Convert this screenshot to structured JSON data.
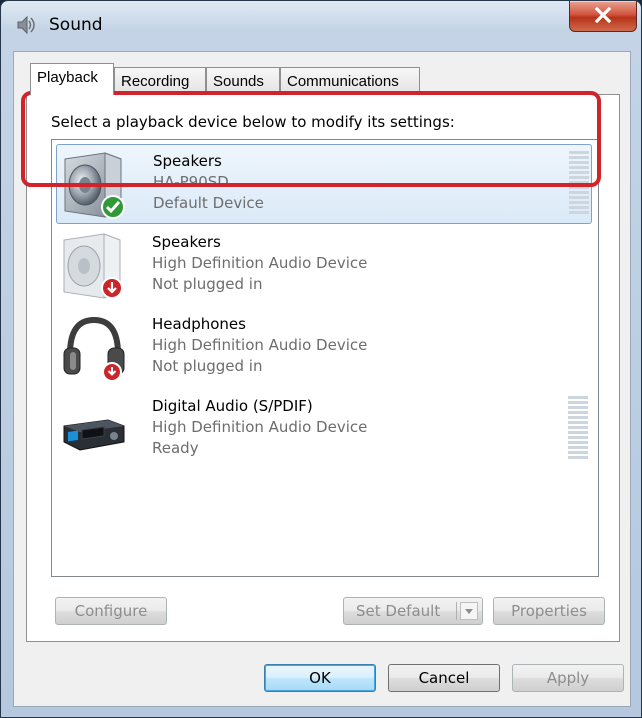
{
  "window": {
    "title": "Sound"
  },
  "tabs": [
    {
      "label": "Playback",
      "active": true
    },
    {
      "label": "Recording",
      "active": false
    },
    {
      "label": "Sounds",
      "active": false
    },
    {
      "label": "Communications",
      "active": false
    }
  ],
  "instruction": "Select a playback device below to modify its settings:",
  "devices": [
    {
      "name": "Speakers",
      "description": "HA-P90SD",
      "status": "Default Device",
      "icon": "speaker-default-icon",
      "selected": true
    },
    {
      "name": "Speakers",
      "description": "High Definition Audio Device",
      "status": "Not plugged in",
      "icon": "speaker-unplugged-icon",
      "selected": false
    },
    {
      "name": "Headphones",
      "description": "High Definition Audio Device",
      "status": "Not plugged in",
      "icon": "headphones-unplugged-icon",
      "selected": false
    },
    {
      "name": "Digital Audio (S/PDIF)",
      "description": "High Definition Audio Device",
      "status": "Ready",
      "icon": "digital-audio-icon",
      "selected": false
    }
  ],
  "buttons": {
    "configure": "Configure",
    "set_default": "Set Default",
    "properties": "Properties",
    "ok": "OK",
    "cancel": "Cancel",
    "apply": "Apply"
  },
  "colors": {
    "highlight": "#d2232a",
    "selection": "#dbeaf8",
    "status_text": "#6d6d6d"
  }
}
